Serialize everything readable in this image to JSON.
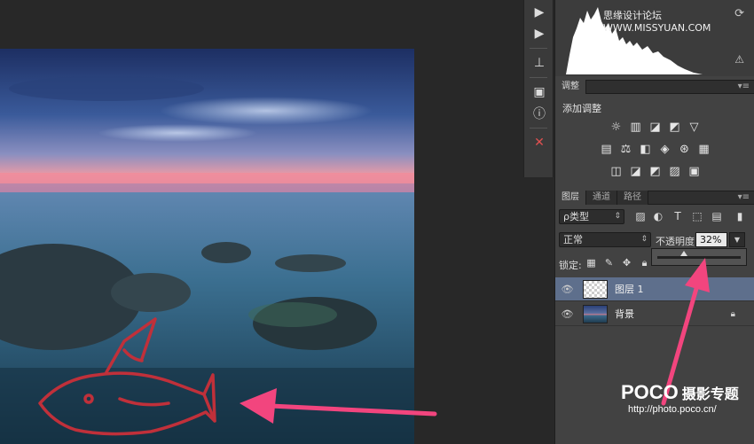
{
  "watermark": {
    "top": "思缘设计论坛 WWW.MISSYUAN.COM",
    "logo": "POCO",
    "title": "摄影专题",
    "url": "http://photo.poco.cn/"
  },
  "toolstrip": {
    "tools": [
      "play-icon",
      "stamp-icon",
      "layer-comps-icon",
      "info-icon",
      "close-tools-icon"
    ]
  },
  "histogram": {
    "refresh": "⟳",
    "warning": "⚠"
  },
  "adjustments": {
    "tab": "调整",
    "title": "添加调整",
    "row1": [
      "☼",
      "▥",
      "◪",
      "◩",
      "▽"
    ],
    "row2": [
      "▤",
      "⚖",
      "◧",
      "◈",
      "⊛",
      "▦"
    ],
    "row3": [
      "◫",
      "◪",
      "◩",
      "▨",
      "▣"
    ]
  },
  "layers": {
    "tabs": [
      "图层",
      "通道",
      "路径"
    ],
    "filter": "ρ类型",
    "blend_mode": "正常",
    "opacity_label": "不透明度:",
    "opacity_value": "32%",
    "opacity_fraction": 0.32,
    "lock_label": "锁定:",
    "items": [
      {
        "name": "图层 1",
        "selected": true,
        "locked": false
      },
      {
        "name": "背景",
        "selected": false,
        "locked": true
      }
    ]
  },
  "colors": {
    "accent_arrow": "#f2457e",
    "drawing": "#c0303a",
    "selected_layer": "#5e6f8c"
  }
}
